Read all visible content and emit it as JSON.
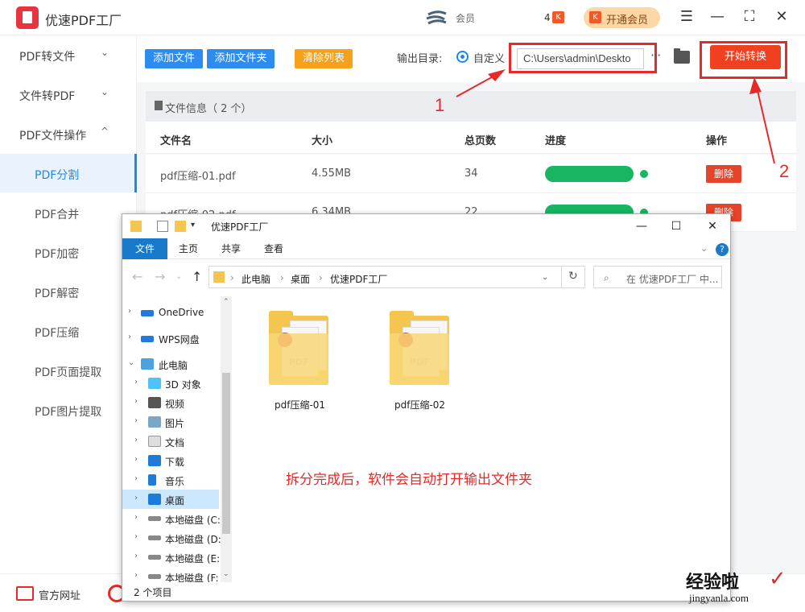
{
  "app": {
    "title": "优速PDF工厂",
    "member_text": "会员",
    "count": "4",
    "vip_label": "开通会员"
  },
  "sidebar": {
    "groups": [
      {
        "label": "PDF转文件",
        "chevron": "⌄"
      },
      {
        "label": "文件转PDF",
        "chevron": "⌄"
      },
      {
        "label": "PDF文件操作",
        "chevron": "^"
      }
    ],
    "items": [
      "PDF分割",
      "PDF合并",
      "PDF加密",
      "PDF解密",
      "PDF压缩",
      "PDF页面提取",
      "PDF图片提取"
    ],
    "active": "PDF分割"
  },
  "toolbar": {
    "add_file": "添加文件",
    "add_folder": "添加文件夹",
    "clear_list": "清除列表",
    "output_label": "输出目录:",
    "custom_label": "自定义",
    "output_path": "C:\\Users\\admin\\Deskto",
    "more": "···",
    "start": "开始转换"
  },
  "file_info": "文件信息（ 2 个）",
  "table": {
    "headers": [
      "文件名",
      "大小",
      "总页数",
      "进度",
      "操作"
    ],
    "rows": [
      {
        "name": "pdf压缩-01.pdf",
        "size": "4.55MB",
        "pages": "34",
        "progress": 1.0,
        "action": "删除"
      },
      {
        "name": "pdf压缩-02.pdf",
        "size": "6.34MB",
        "pages": "22",
        "progress": 1.0,
        "action": "删除"
      }
    ]
  },
  "annotations": {
    "n1": "1",
    "n2": "2",
    "notice": "拆分完成后，软件会自动打开输出文件夹"
  },
  "footer": {
    "website": "官方网址"
  },
  "explorer": {
    "title": "优速PDF工厂",
    "tabs": [
      "文件",
      "主页",
      "共享",
      "查看"
    ],
    "breadcrumb": [
      "此电脑",
      "桌面",
      "优速PDF工厂"
    ],
    "search_placeholder": "在 优速PDF工厂 中...",
    "tree": [
      {
        "label": "OneDrive"
      },
      {
        "label": "WPS网盘"
      },
      {
        "label": "此电脑"
      },
      {
        "label": "3D 对象"
      },
      {
        "label": "视频"
      },
      {
        "label": "图片"
      },
      {
        "label": "文档"
      },
      {
        "label": "下载"
      },
      {
        "label": "音乐"
      },
      {
        "label": "桌面"
      },
      {
        "label": "本地磁盘 (C:"
      },
      {
        "label": "本地磁盘 (D:"
      },
      {
        "label": "本地磁盘 (E:"
      },
      {
        "label": "本地磁盘 (F:"
      }
    ],
    "folders": [
      "pdf压缩-01",
      "pdf压缩-02"
    ],
    "status": "2 个项目"
  },
  "watermark": {
    "cn": "经验啦",
    "url": "jingyanla.com"
  }
}
